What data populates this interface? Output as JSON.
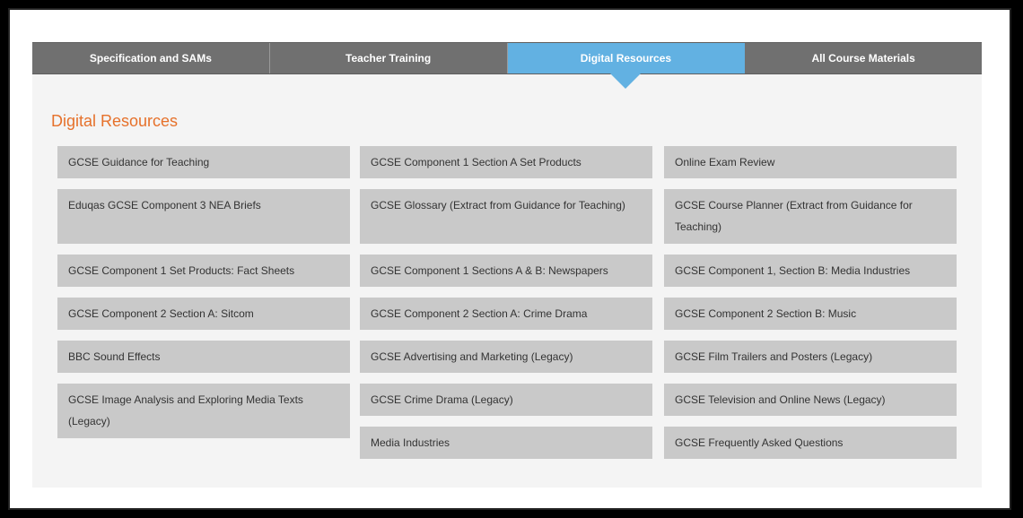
{
  "tabs": [
    {
      "label": "Specification and SAMs",
      "active": false
    },
    {
      "label": "Teacher Training",
      "active": false
    },
    {
      "label": "Digital Resources",
      "active": true
    },
    {
      "label": "All Course Materials",
      "active": false
    }
  ],
  "section_title": "Digital Resources",
  "colors": {
    "accent_tab": "#62b1e2",
    "title": "#e6712b",
    "item_bg": "#c9c9c9",
    "tab_bg": "#707070"
  },
  "columns": [
    [
      "GCSE Guidance for Teaching",
      "Eduqas GCSE Component 3 NEA Briefs",
      "GCSE Component 1 Set Products: Fact Sheets",
      "GCSE Component 2 Section A: Sitcom",
      "BBC Sound Effects",
      "GCSE Image Analysis and Exploring Media Texts (Legacy)"
    ],
    [
      "GCSE Component 1 Section A Set Products",
      "GCSE Glossary (Extract from Guidance for Teaching)",
      "GCSE Component 1 Sections A & B: Newspapers",
      "GCSE Component 2 Section A: Crime Drama",
      "GCSE Advertising and Marketing (Legacy)",
      "GCSE Crime Drama (Legacy)",
      "Media Industries"
    ],
    [
      "Online Exam Review",
      "GCSE Course Planner (Extract from Guidance for Teaching)",
      "GCSE Component 1, Section B: Media Industries",
      "GCSE Component 2 Section B: Music",
      "GCSE Film Trailers and Posters (Legacy)",
      "GCSE Television and Online News (Legacy)",
      "GCSE Frequently Asked Questions"
    ]
  ]
}
